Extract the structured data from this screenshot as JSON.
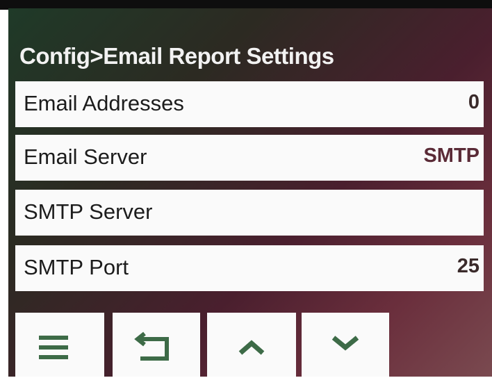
{
  "screen": {
    "title": "Config>Email Report Settings",
    "rows": [
      {
        "label": "Email Addresses",
        "value": "0"
      },
      {
        "label": "Email Server",
        "value": "SMTP"
      },
      {
        "label": "SMTP Server",
        "value": ""
      },
      {
        "label": "SMTP Port",
        "value": "25"
      }
    ]
  },
  "buttons": [
    {
      "icon": "menu-icon"
    },
    {
      "icon": "back-icon"
    },
    {
      "icon": "chevron-up-icon"
    },
    {
      "icon": "chevron-down-icon"
    }
  ],
  "colors": {
    "row_background": "#fafafa",
    "value_text": "#5a2a36",
    "title_text": "#f2f2f2"
  }
}
